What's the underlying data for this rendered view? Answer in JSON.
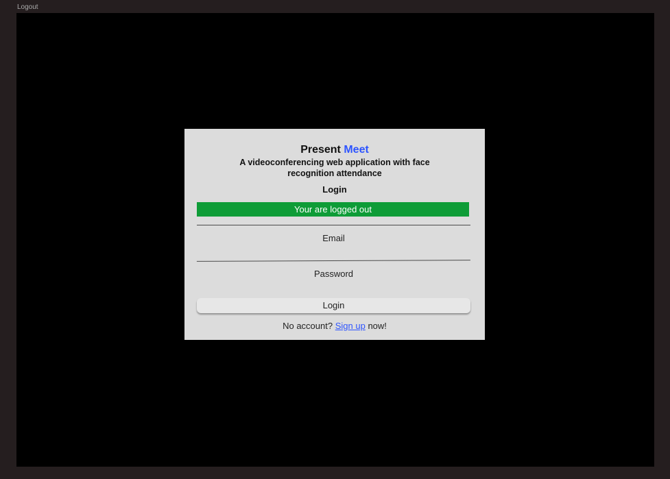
{
  "nav": {
    "logout_label": "Logout"
  },
  "card": {
    "title_prefix": "Present",
    "title_accent": "Meet",
    "subtitle": "A videoconferencing web application with face recognition attendance",
    "heading": "Login",
    "status_message": "Your are logged out",
    "email_label": "Email",
    "password_label": "Password",
    "login_button_label": "Login",
    "signup_prefix": "No account?",
    "signup_link": "Sign up",
    "signup_suffix": "now!"
  },
  "colors": {
    "page_background": "#251e1f",
    "stage_background": "#000000",
    "card_background": "#dcdcdc",
    "accent": "#2e55ff",
    "success": "#0e9c37"
  }
}
